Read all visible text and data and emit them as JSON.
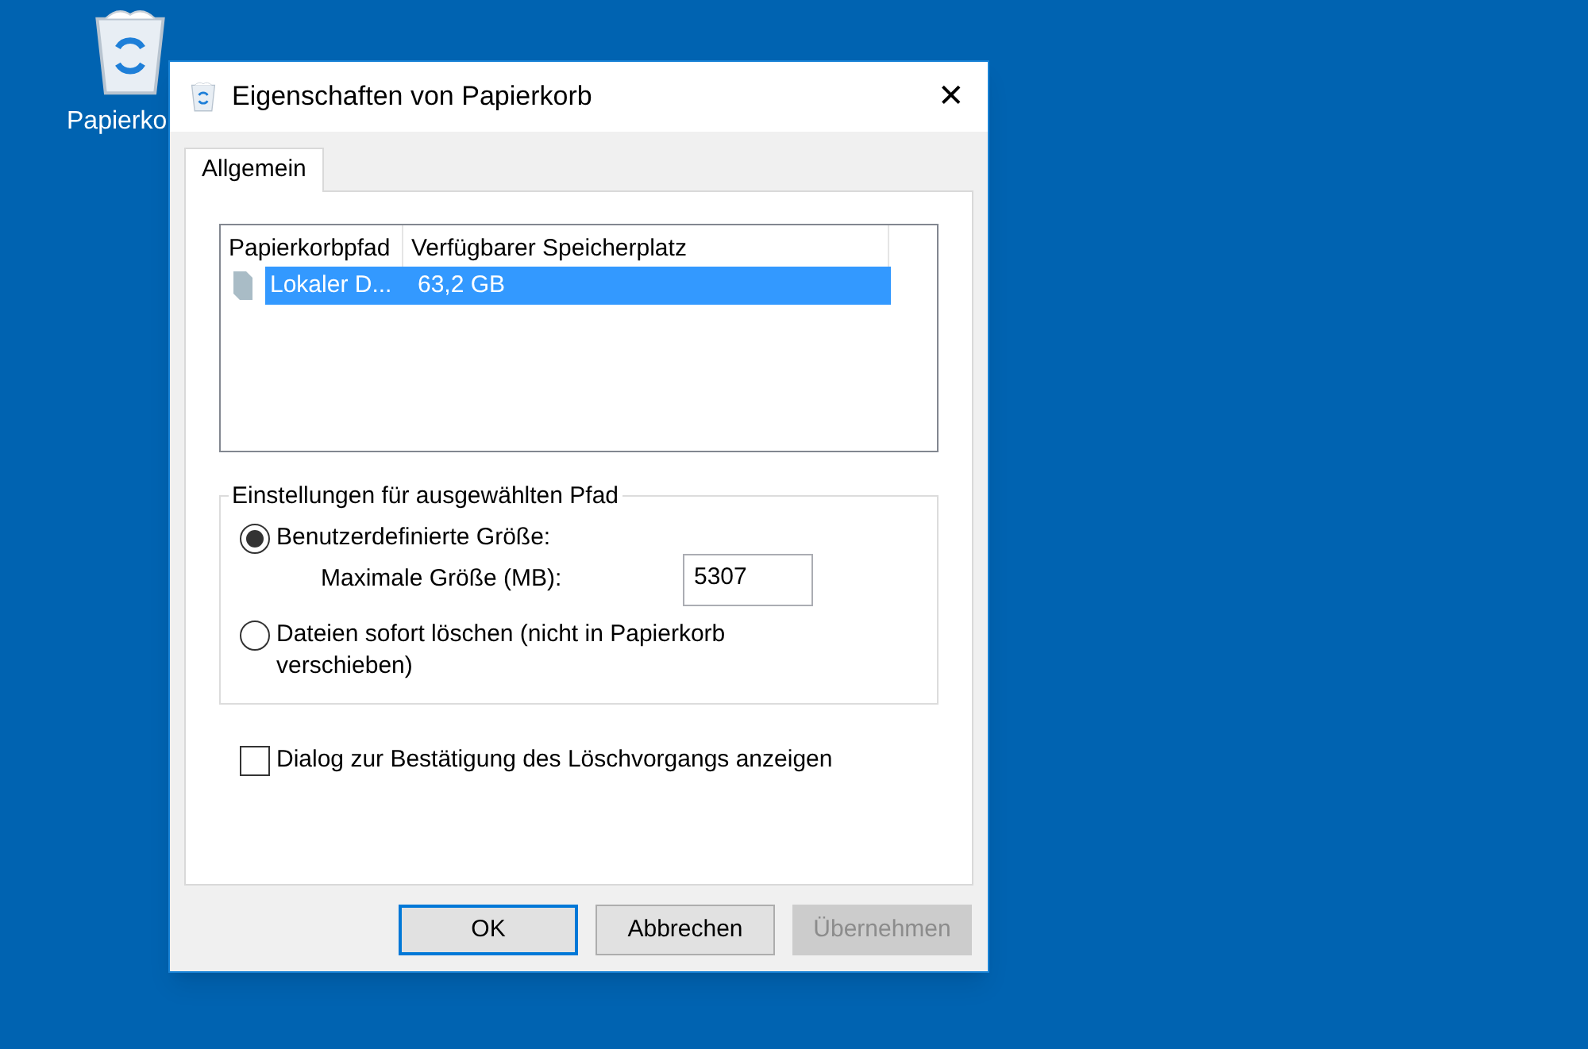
{
  "desktop": {
    "icons": [
      {
        "label": "Papierko"
      }
    ]
  },
  "window": {
    "title": "Eigenschaften von Papierkorb",
    "close": "✕"
  },
  "tabs": [
    {
      "label": "Allgemein",
      "selected": true
    }
  ],
  "list": {
    "columns": [
      "Papierkorbpfad",
      "Verfügbarer Speicherplatz"
    ],
    "rows": [
      {
        "cells": [
          "Lokaler D...",
          "63,2 GB"
        ],
        "selected": true
      }
    ]
  },
  "group": {
    "title": "Einstellungen für ausgewählten Pfad",
    "options": [
      {
        "label": "Benutzerdefinierte Größe:",
        "selected": true,
        "field": {
          "label": "Maximale Größe (MB):",
          "value": "5307"
        }
      },
      {
        "label": "Dateien sofort löschen (nicht in Papierkorb verschieben)",
        "selected": false
      }
    ]
  },
  "confirm": {
    "label": "Dialog zur Bestätigung des Löschvorgangs anzeigen",
    "checked": false
  },
  "buttons": [
    {
      "label": "OK",
      "default": true,
      "disabled": false
    },
    {
      "label": "Abbrechen",
      "default": false,
      "disabled": false
    },
    {
      "label": "Übernehmen",
      "default": false,
      "disabled": true
    }
  ]
}
